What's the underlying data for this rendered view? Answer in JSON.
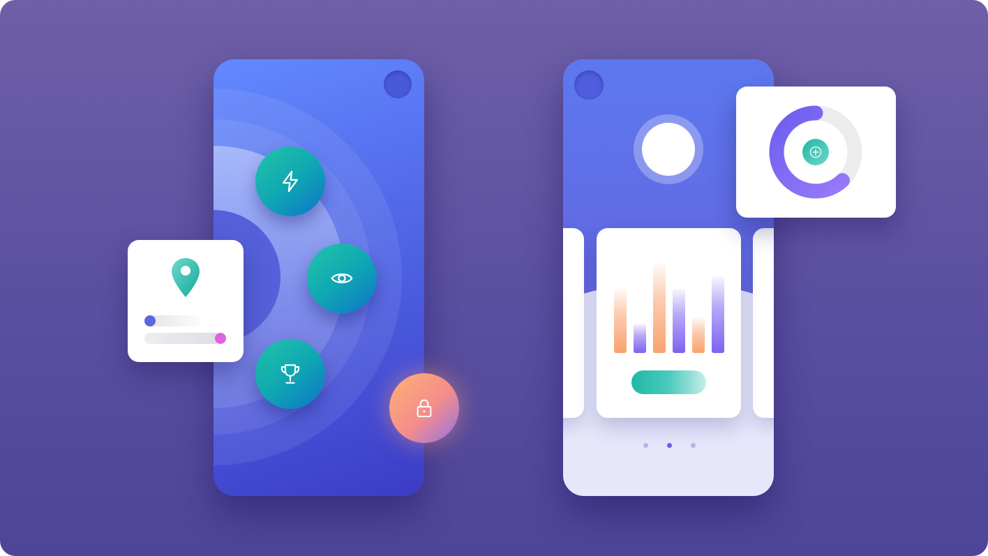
{
  "colors": {
    "background": "#5e54a3",
    "phone_blue": "#4f63e4",
    "teal": "#1fb8a6",
    "orange": "#f9a26e",
    "purple": "#7e62f0",
    "pink": "#df63e0"
  },
  "left_phone": {
    "features": [
      {
        "name": "bolt",
        "icon": "lightning-bolt-icon"
      },
      {
        "name": "eye",
        "icon": "eye-icon"
      },
      {
        "name": "trophy",
        "icon": "trophy-icon"
      }
    ],
    "lock": {
      "icon": "lock-icon"
    }
  },
  "location_card": {
    "icon": "map-pin-icon",
    "sliders": [
      {
        "level": 0.0,
        "knob_color": "#5a67dd"
      },
      {
        "level": 1.0,
        "knob_color": "#df63e0"
      }
    ]
  },
  "right_phone": {
    "avatar": "avatar-placeholder",
    "chart": {
      "type": "bar",
      "values": [
        0.72,
        0.33,
        1.0,
        0.72,
        0.4,
        0.86
      ],
      "colors": [
        "orange",
        "purple",
        "orange",
        "purple",
        "orange",
        "purple"
      ]
    },
    "pagination": {
      "pages": 3,
      "active_index": 1
    }
  },
  "donut_card": {
    "progress": 0.62,
    "icon": "plus-circle-icon"
  }
}
